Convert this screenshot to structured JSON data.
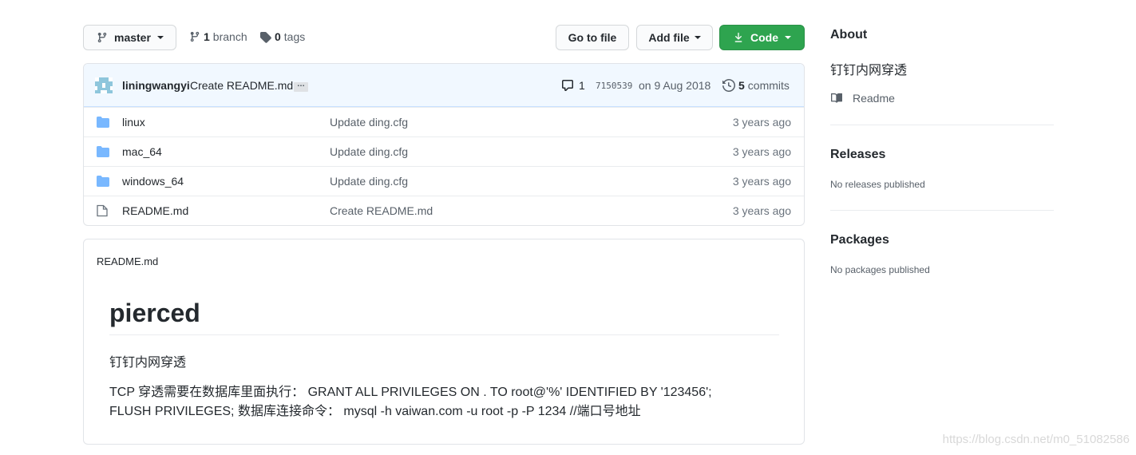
{
  "toolbar": {
    "branch_label": "master",
    "branch_count": "1",
    "branch_word": "branch",
    "tag_count": "0",
    "tag_word": "tags",
    "goto_label": "Go to file",
    "addfile_label": "Add file",
    "code_label": "Code"
  },
  "commit": {
    "author": "liningwangyi",
    "message": "Create README.md",
    "ellipsis": "…",
    "comments": "1",
    "sha": "7150539",
    "date": "on 9 Aug 2018",
    "count": "5",
    "count_word": "commits"
  },
  "files": [
    {
      "name": "linux",
      "message": "Update ding.cfg",
      "age": "3 years ago",
      "type": "folder"
    },
    {
      "name": "mac_64",
      "message": "Update ding.cfg",
      "age": "3 years ago",
      "type": "folder"
    },
    {
      "name": "windows_64",
      "message": "Update ding.cfg",
      "age": "3 years ago",
      "type": "folder"
    },
    {
      "name": "README.md",
      "message": "Create README.md",
      "age": "3 years ago",
      "type": "file"
    }
  ],
  "readme": {
    "header": "README.md",
    "title": "pierced",
    "p1": "钉钉内网穿透",
    "p2": "TCP 穿透需要在数据库里面执行：  GRANT ALL PRIVILEGES ON . TO root@'%' IDENTIFIED BY '123456'; FLUSH PRIVILEGES; 数据库连接命令：  mysql -h vaiwan.com -u root -p -P 1234 //端口号地址"
  },
  "sidebar": {
    "about_title": "About",
    "about_desc": "钉钉内网穿透",
    "readme_link": "Readme",
    "releases_title": "Releases",
    "releases_text": "No releases published",
    "packages_title": "Packages",
    "packages_text": "No packages published"
  },
  "watermark": "https://blog.csdn.net/m0_51082586",
  "colors": {
    "code_button": "#2ea44f",
    "folder_icon": "#79b8ff",
    "commit_bar": "#f1f8ff"
  }
}
